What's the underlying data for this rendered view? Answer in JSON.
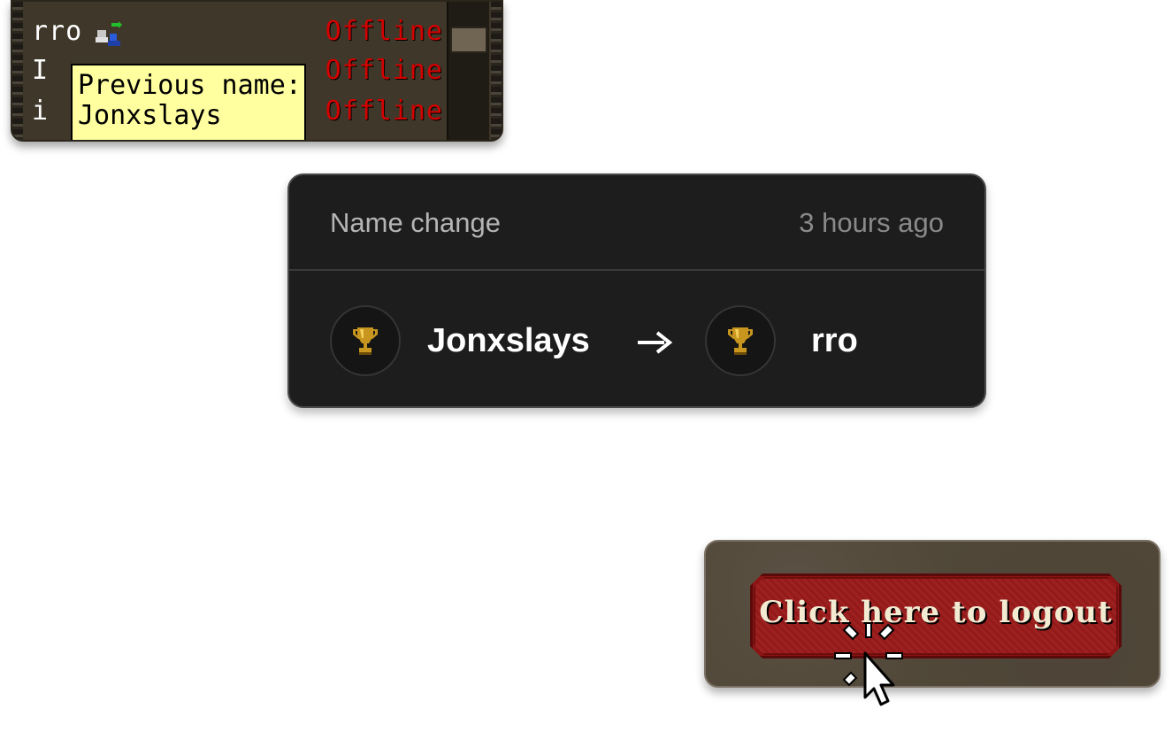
{
  "friends_list": {
    "rows": [
      {
        "name": "rro",
        "status": "Offline"
      },
      {
        "name": "I",
        "status": "Offline"
      },
      {
        "name": "i",
        "status": "Offline"
      }
    ],
    "tooltip": {
      "line1": "Previous name:",
      "line2": "Jonxslays"
    },
    "status_color": "#d40000"
  },
  "name_change_card": {
    "title": "Name change",
    "timestamp": "3 hours ago",
    "old_name": "Jonxslays",
    "new_name": "rro",
    "old_avatar_icon": "trophy-icon",
    "new_avatar_icon": "trophy-icon",
    "arrow_icon": "arrow-right-icon"
  },
  "logout": {
    "button_label": "Click here to logout",
    "cursor_icon": "click-cursor-icon"
  }
}
